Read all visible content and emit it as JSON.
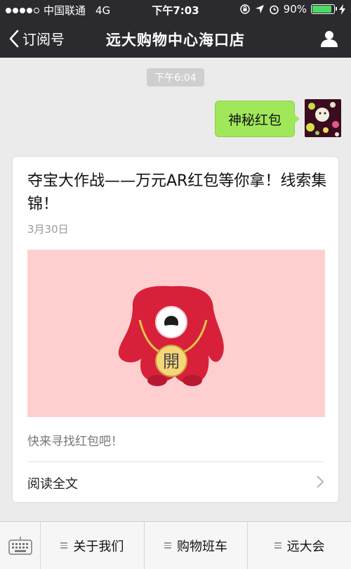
{
  "status_bar": {
    "carrier": "中国联通",
    "network": "4G",
    "time": "下午7:03",
    "battery_text": "90%",
    "battery_level": 0.9
  },
  "nav": {
    "back_label": "订阅号",
    "title": "远大购物中心海口店"
  },
  "chat": {
    "timestamp": "下午6:04",
    "message": "神秘红包"
  },
  "article": {
    "title": "夺宝大作战——万元AR红包等你拿！线索集锦！",
    "date": "3月30日",
    "image_text": "開",
    "description": "快来寻找红包吧！",
    "read_more": "阅读全文"
  },
  "menu": {
    "items": [
      "关于我们",
      "购物班车",
      "远大会"
    ]
  },
  "colors": {
    "dark_bar": "#2b2b2f",
    "bubble_green": "#a0e75a",
    "image_bg": "#ffcfd0",
    "battery_green": "#4cd964"
  }
}
